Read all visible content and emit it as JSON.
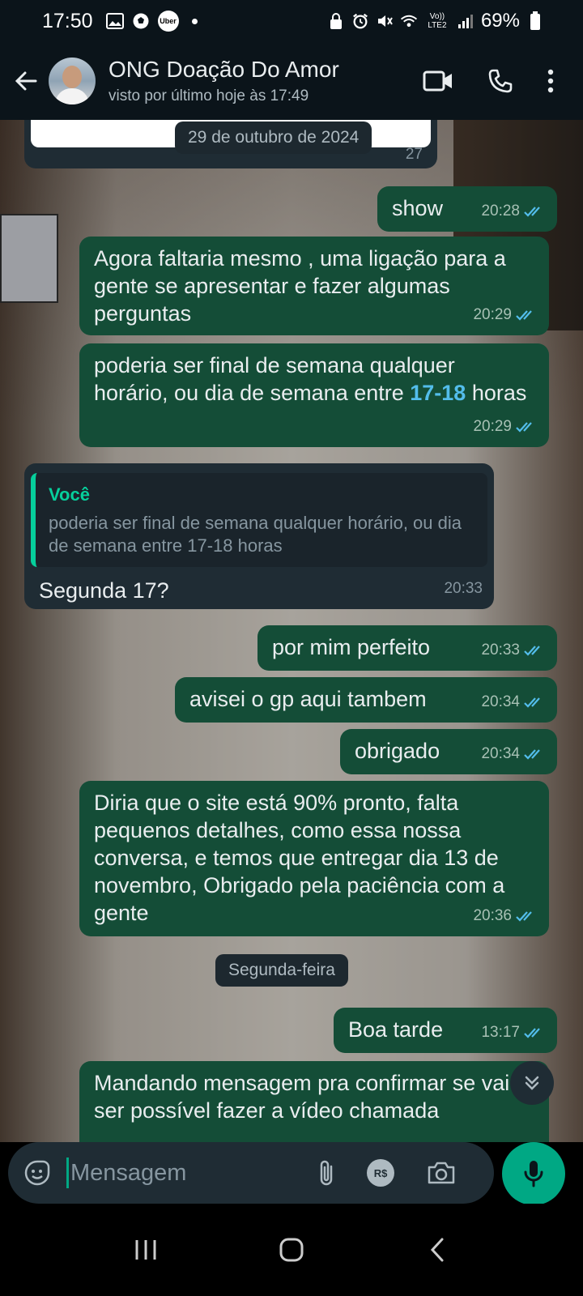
{
  "status_bar": {
    "time": "17:50",
    "uber_label": "Uber",
    "network_label": "Vo)) LTE2",
    "battery": "69%"
  },
  "header": {
    "contact_name": "ONG Doação Do Amor",
    "last_seen": "visto por último hoje às 17:49"
  },
  "chat": {
    "previous_partial_time": "27",
    "date_separator_1": "29 de outubro de 2024",
    "messages": [
      {
        "text": "show",
        "time": "20:28"
      },
      {
        "text": "Agora faltaria mesmo , uma ligação para a gente se apresentar e fazer algumas perguntas",
        "time": "20:29"
      },
      {
        "text_before": "poderia ser final de semana qualquer horário, ou dia de semana entre ",
        "highlight": "17-18",
        "text_after": " horas",
        "time": "20:29"
      },
      {
        "quote_author": "Você",
        "quote_text": "poderia ser final de semana qualquer horário, ou dia de semana entre 17-18 horas",
        "text": "Segunda 17?",
        "time": "20:33"
      },
      {
        "text": "por mim perfeito",
        "time": "20:33"
      },
      {
        "text": "avisei o gp aqui tambem",
        "time": "20:34"
      },
      {
        "text": "obrigado",
        "time": "20:34"
      },
      {
        "text": "Diria que o site está 90% pronto, falta pequenos detalhes, como essa nossa conversa, e temos que entregar dia 13 de novembro, Obrigado pela paciência com a gente",
        "time": "20:36"
      },
      {
        "text": "Boa tarde",
        "time": "13:17"
      },
      {
        "text": "Mandando mensagem pra confirmar se vai ser possível fazer a vídeo chamada"
      }
    ],
    "date_separator_2": "Segunda-feira"
  },
  "input": {
    "placeholder": "Mensagem",
    "pay_label": "R$"
  },
  "colors": {
    "outgoing_bubble": "#144d37",
    "incoming_bubble": "#1f2c34",
    "accent": "#00a884",
    "read_ticks": "#53bdeb"
  },
  "icons": [
    "back-arrow-icon",
    "video-call-icon",
    "phone-icon",
    "more-vert-icon",
    "emoji-icon",
    "attach-icon",
    "camera-icon",
    "mic-icon",
    "scroll-down-icon"
  ]
}
